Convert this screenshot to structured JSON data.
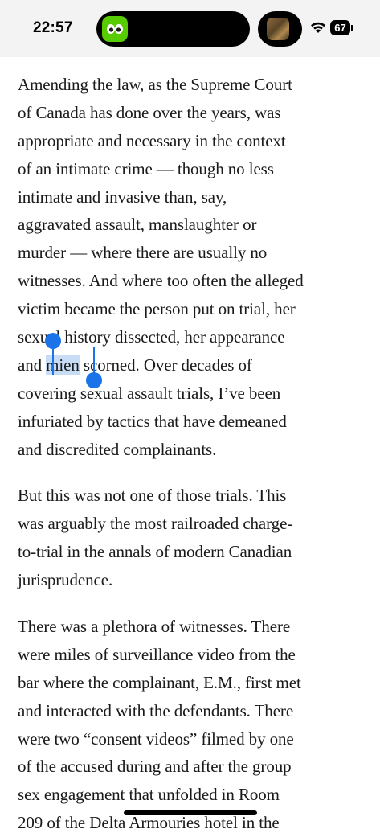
{
  "status_bar": {
    "time": "22:57",
    "battery_level": "67",
    "island_app_icon": "duolingo-owl-icon",
    "island_media_icon": "media-artwork-thumbnail"
  },
  "article": {
    "paragraphs": [
      {
        "lines": [
          "Amending the law, as the Supreme Court",
          "of Canada has done over the years, was",
          "appropriate and necessary in the context",
          "of an intimate crime — though no less",
          "intimate and invasive than, say,",
          "aggravated assault, manslaughter or",
          "murder — where there are usually no",
          "witnesses. And where too often the alleged",
          "victim became the person put on trial, her",
          "sexual history dissected, her appearance",
          {
            "before": "and ",
            "selected": "mien",
            "after": " scorned. Over decades of"
          },
          "covering sexual assault trials, I’ve been",
          "infuriated by tactics that have demeaned",
          "and discredited complainants."
        ]
      },
      {
        "lines": [
          "But this was not one of those trials. This",
          "was arguably the most railroaded charge-",
          "to-trial in the annals of modern Canadian",
          "jurisprudence."
        ]
      },
      {
        "lines": [
          "There was a plethora of witnesses. There",
          "were miles of surveillance video from the",
          "bar where the complainant, E.M., first met",
          "and interacted with the defendants. There",
          "were two “consent videos” filmed by one",
          "of the accused during and after the group",
          "sex engagement that unfolded in Room",
          "209 of the Delta Armouries hotel in the"
        ]
      }
    ]
  },
  "colors": {
    "selection_highlight": "#c8dcf5",
    "selection_handle": "#1a73e8",
    "status_bar_bg": "#f3f3f3",
    "duolingo_green": "#58cc02"
  }
}
